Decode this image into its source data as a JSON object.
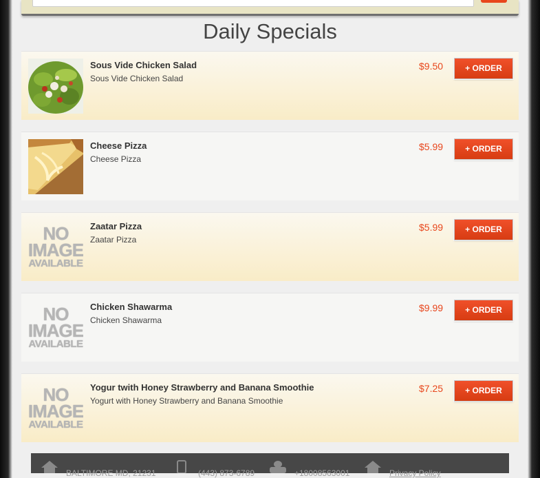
{
  "page": {
    "title": "Daily Specials"
  },
  "search": {
    "placeholder": ""
  },
  "order_label": "+ ORDER",
  "items": [
    {
      "name": "Sous Vide Chicken Salad",
      "description": "Sous Vide Chicken Salad",
      "price": "$9.50",
      "image": "salad-photo"
    },
    {
      "name": "Cheese Pizza",
      "description": "Cheese Pizza",
      "price": "$5.99",
      "image": "pizza-photo"
    },
    {
      "name": "Zaatar Pizza",
      "description": "Zaatar Pizza",
      "price": "$5.99",
      "image": "no-image"
    },
    {
      "name": "Chicken Shawarma",
      "description": "Chicken Shawarma",
      "price": "$9.99",
      "image": "no-image"
    },
    {
      "name": "Yogur twith Honey Strawberry and Banana Smoothie",
      "description": "Yogurt with Honey Strawberry and Banana Smoothie",
      "price": "$7.25",
      "image": "no-image"
    }
  ],
  "no_image": {
    "line1": "NO",
    "line2": "IMAGE",
    "line3": "AVAILABLE"
  },
  "footer": {
    "address": "BALTIMORE MD, 21231",
    "phone": "(443) 873-6789",
    "fax": "+18008563001",
    "privacy": "Privacy Policy"
  },
  "colors": {
    "accent": "#e8461c",
    "footer_bg": "#474747"
  }
}
